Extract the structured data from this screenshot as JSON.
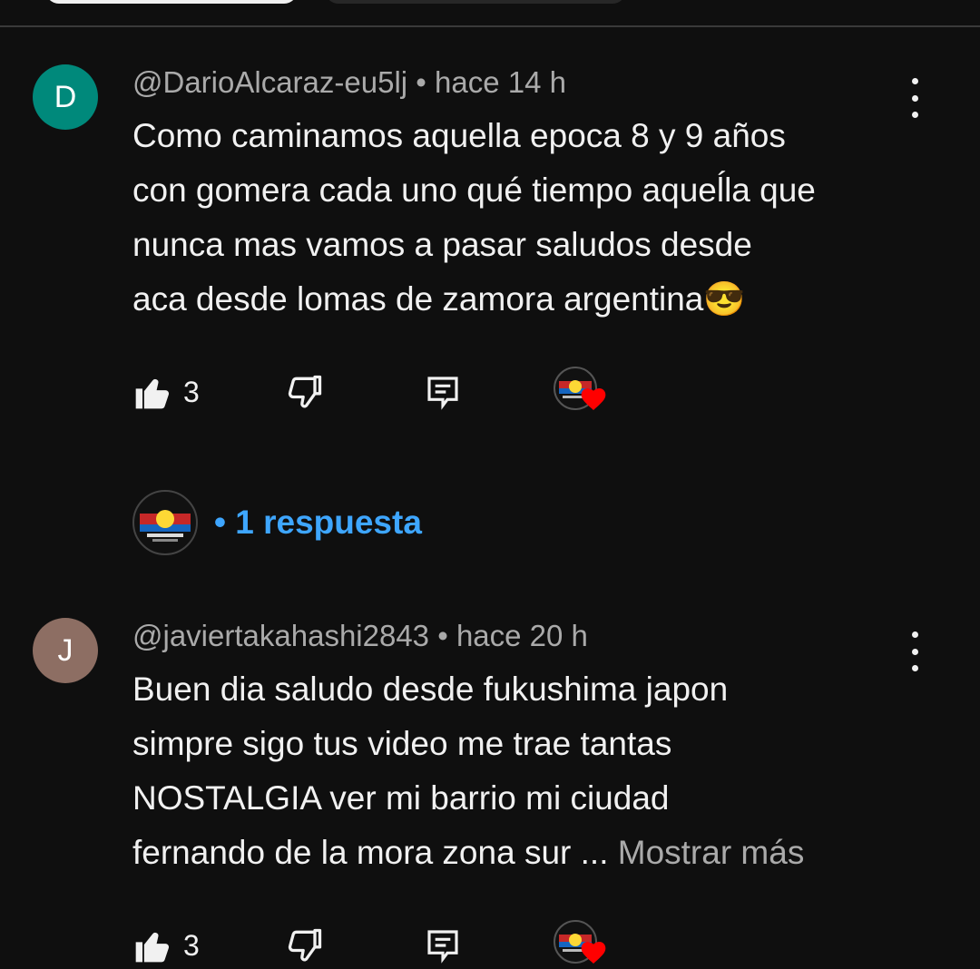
{
  "comments": [
    {
      "avatar_letter": "D",
      "avatar_color": "#00897b",
      "author": "@DarioAlcaraz-eu5lj",
      "separator": "•",
      "time": "hace 14 h",
      "text_lines": [
        "Como caminamos aquella epoca 8 y 9 años",
        "con gomera cada uno qué tiempo aqueĺla que",
        "nunca mas vamos a pasar  saludos desde",
        "aca desde lomas de zamora argentina"
      ],
      "emoji": "😎",
      "likes": "3",
      "replies_label": "• 1 respuesta"
    },
    {
      "avatar_letter": "J",
      "avatar_color": "#8d6e63",
      "author": "@javiertakahashi2843",
      "separator": "•",
      "time": "hace 20 h",
      "text_lines": [
        "Buen dia  saludo desde fukushima japon",
        "simpre sigo tus video me trae tantas",
        "NOSTALGIA    ver  mi barrio  mi ciudad",
        "fernando de la mora zona sur ... "
      ],
      "more_label": "Mostrar más",
      "likes": "3"
    }
  ],
  "icons": {
    "like": "thumb-up-icon",
    "dislike": "thumb-down-icon",
    "reply": "comment-icon",
    "menu": "more-vert-icon",
    "heart": "heart-icon"
  },
  "colors": {
    "background": "#0f0f0f",
    "accent_link": "#3ea6ff",
    "heart": "#ff0000"
  }
}
